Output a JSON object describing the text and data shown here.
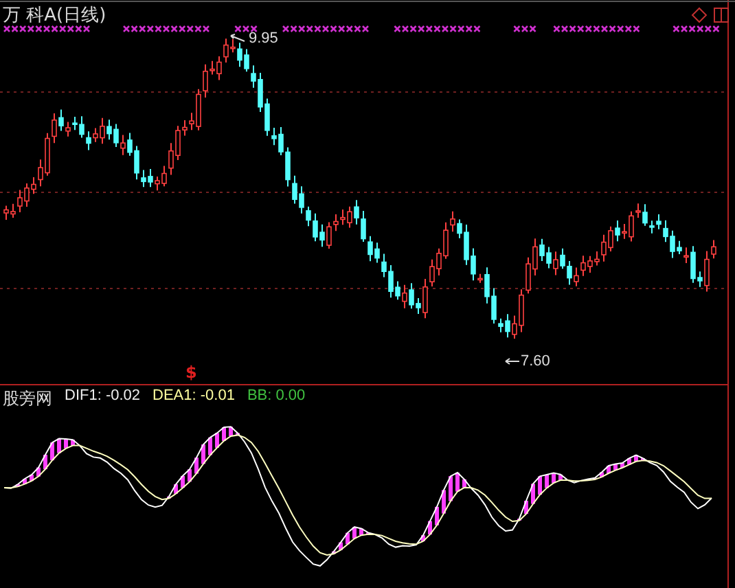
{
  "title": "万 科A(日线)",
  "price_chart": {
    "high_label": "9.95",
    "low_label": "7.60",
    "signal_mark": "$"
  },
  "indicator": {
    "name": "股旁网",
    "dif": "DIF1: -0.02",
    "dea": "DEA1: -0.01",
    "bb": "BB: 0.00"
  }
}
